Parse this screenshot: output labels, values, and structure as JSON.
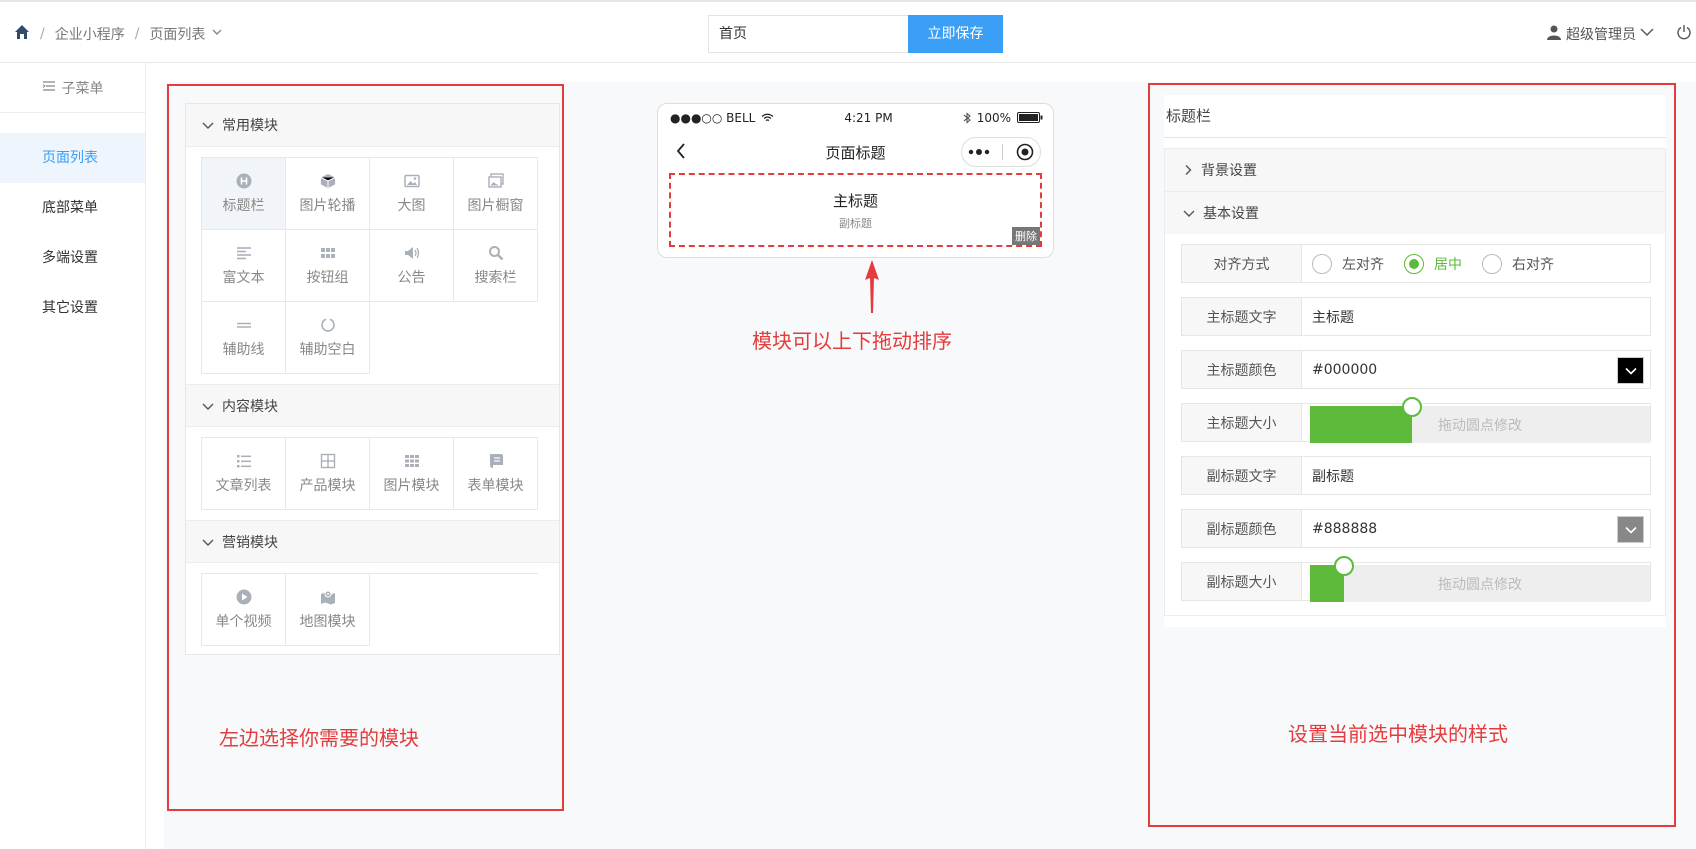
{
  "breadcrumb": {
    "home_icon": "home-icon",
    "item1": "企业小程序",
    "item2": "页面列表",
    "separator": "/"
  },
  "header": {
    "page_title_value": "首页",
    "save_label": "立即保存",
    "user_name": "超级管理员",
    "user_icon": "user-icon",
    "power_icon": "power-icon"
  },
  "sidebar": {
    "submenu_label": "子菜单",
    "items": [
      {
        "label": "页面列表",
        "active": true
      },
      {
        "label": "底部菜单",
        "active": false
      },
      {
        "label": "多端设置",
        "active": false
      },
      {
        "label": "其它设置",
        "active": false
      }
    ]
  },
  "modules": {
    "groups": [
      {
        "title": "常用模块",
        "items": [
          {
            "label": "标题栏",
            "icon": "heading-icon",
            "selected": true
          },
          {
            "label": "图片轮播",
            "icon": "cube-icon"
          },
          {
            "label": "大图",
            "icon": "image-icon"
          },
          {
            "label": "图片橱窗",
            "icon": "images-icon"
          },
          {
            "label": "富文本",
            "icon": "align-left-icon"
          },
          {
            "label": "按钮组",
            "icon": "grid-buttons-icon"
          },
          {
            "label": "公告",
            "icon": "speaker-icon"
          },
          {
            "label": "搜索栏",
            "icon": "search-icon"
          },
          {
            "label": "辅助线",
            "icon": "divider-icon"
          },
          {
            "label": "辅助空白",
            "icon": "circle-notch-icon"
          }
        ]
      },
      {
        "title": "内容模块",
        "items": [
          {
            "label": "文章列表",
            "icon": "list-icon"
          },
          {
            "label": "产品模块",
            "icon": "th-icon"
          },
          {
            "label": "图片模块",
            "icon": "th-large-icon"
          },
          {
            "label": "表单模块",
            "icon": "form-icon"
          }
        ]
      },
      {
        "title": "营销模块",
        "items": [
          {
            "label": "单个视频",
            "icon": "play-icon"
          },
          {
            "label": "地图模块",
            "icon": "map-icon"
          }
        ]
      }
    ]
  },
  "phone": {
    "carrier": "●●●○○ BELL",
    "time": "4:21 PM",
    "battery": "100%",
    "nav_title": "页面标题",
    "module_main_title": "主标题",
    "module_sub_title": "副标题",
    "delete_label": "删除"
  },
  "settings": {
    "panel_title": "标题栏",
    "bg_section": "背景设置",
    "basic_section": "基本设置",
    "align": {
      "label": "对齐方式",
      "options": [
        "左对齐",
        "居中",
        "右对齐"
      ],
      "selected": "居中"
    },
    "main_title_text": {
      "label": "主标题文字",
      "value": "主标题"
    },
    "main_title_color": {
      "label": "主标题颜色",
      "value": "#000000",
      "swatch": "#000000"
    },
    "main_title_size": {
      "label": "主标题大小",
      "hint": "拖动圆点修改",
      "level": 0.3
    },
    "sub_title_text": {
      "label": "副标题文字",
      "value": "副标题"
    },
    "sub_title_color": {
      "label": "副标题颜色",
      "value": "#888888",
      "swatch": "#888888"
    },
    "sub_title_size": {
      "label": "副标题大小",
      "hint": "拖动圆点修改",
      "level": 0.1
    }
  },
  "annotations": {
    "drag_note": "模块可以上下拖动排序",
    "left_note": "左边选择你需要的模块",
    "right_note": "设置当前选中模块的样式"
  },
  "colors": {
    "accent": "#3a9ff5",
    "green": "#5dba3a",
    "annotation_red": "#e43c3c"
  }
}
